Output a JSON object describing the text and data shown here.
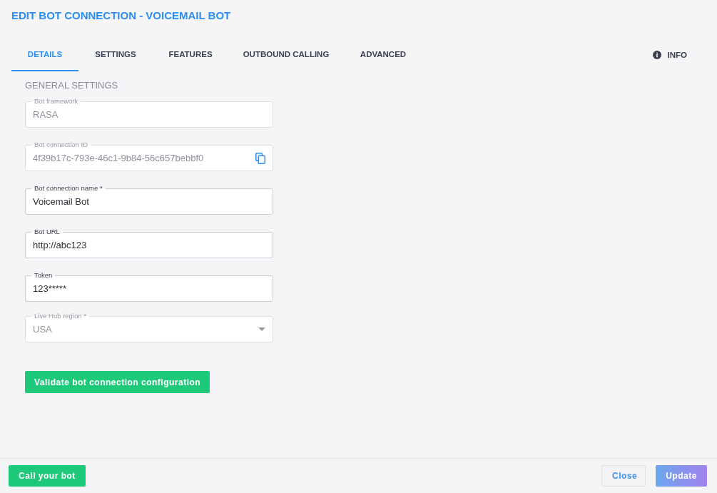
{
  "title": "EDIT BOT CONNECTION - VOICEMAIL BOT",
  "tabs": [
    {
      "label": "DETAILS",
      "selected": true
    },
    {
      "label": "SETTINGS",
      "selected": false
    },
    {
      "label": "FEATURES",
      "selected": false
    },
    {
      "label": "OUTBOUND CALLING",
      "selected": false
    },
    {
      "label": "ADVANCED",
      "selected": false
    }
  ],
  "info": {
    "label": "INFO"
  },
  "section_title": "GENERAL SETTINGS",
  "fields": [
    {
      "kind": "text",
      "label": "Bot framework",
      "value": "RASA",
      "disabled": true
    },
    {
      "kind": "copy",
      "label": "Bot connection ID",
      "value": "4f39b17c-793e-46c1-9b84-56c657bebbf0",
      "disabled": true
    },
    {
      "kind": "text",
      "label": "Bot connection name *",
      "value": "Voicemail Bot",
      "disabled": false
    },
    {
      "kind": "text",
      "label": "Bot URL",
      "value": "http://abc123",
      "disabled": false
    },
    {
      "kind": "text",
      "label": "Token",
      "value": "123*****",
      "disabled": false
    },
    {
      "kind": "select",
      "label": "Live Hub region *",
      "value": "USA",
      "disabled": true
    }
  ],
  "validate_button": "Validate bot connection configuration",
  "footer": {
    "call_button": "Call your bot",
    "close_button": "Close",
    "update_button": {
      "label": "Update",
      "disabled": true
    }
  }
}
